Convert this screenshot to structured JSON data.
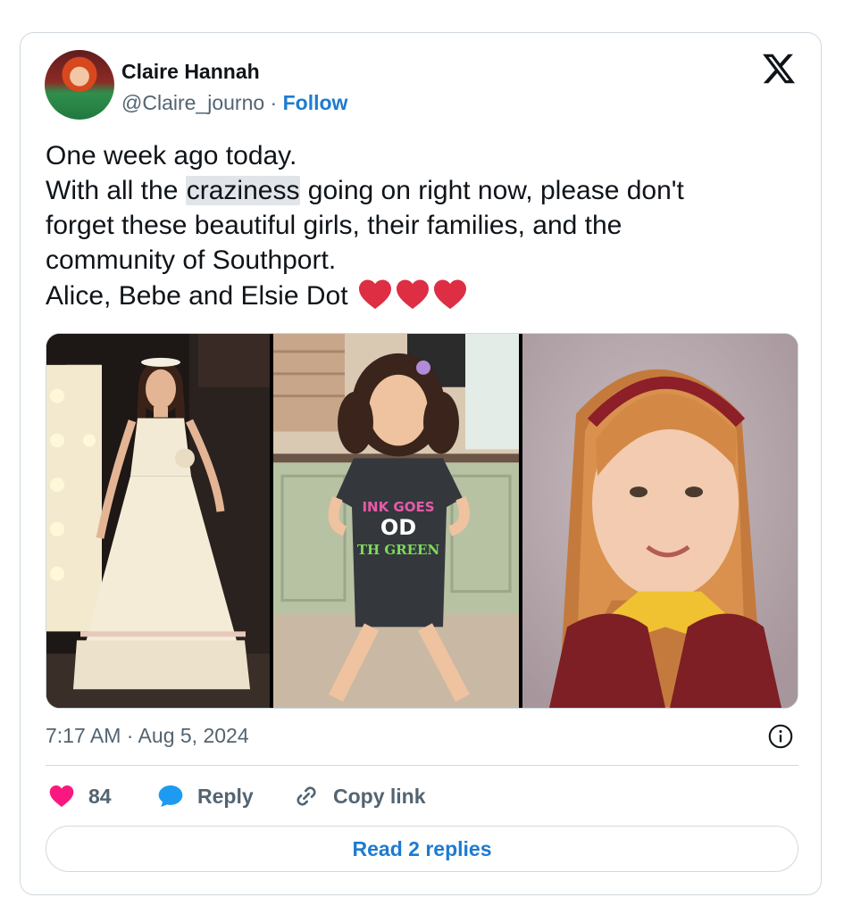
{
  "author": {
    "display_name": "Claire Hannah",
    "handle": "@Claire_journo",
    "separator": " · ",
    "follow_label": "Follow"
  },
  "tweet": {
    "line1": "One week ago today.",
    "line2_before": "With all the ",
    "line2_highlight": "craziness",
    "line2_after": " going on right now, please don't",
    "line3": "forget these beautiful girls, their families, and the",
    "line4": "community of Southport.",
    "line5": "Alice, Bebe and Elsie Dot ",
    "emoji": [
      "red-heart",
      "red-heart",
      "red-heart"
    ]
  },
  "media": {
    "photo_count": 3,
    "shirt_text": [
      "INK GOES",
      "OD",
      "TH GREEN"
    ]
  },
  "meta": {
    "timestamp": "7:17 AM · Aug 5, 2024"
  },
  "actions": {
    "like_count": "84",
    "reply_label": "Reply",
    "copy_link_label": "Copy link"
  },
  "replies": {
    "read_label": "Read 2 replies"
  },
  "colors": {
    "accent": "#1d7bd1",
    "heart": "#f91880",
    "reply_bubble": "#1d9bf0",
    "emoji_heart": "#dd2e44",
    "muted_text": "#536471",
    "border": "#cfd9de"
  }
}
